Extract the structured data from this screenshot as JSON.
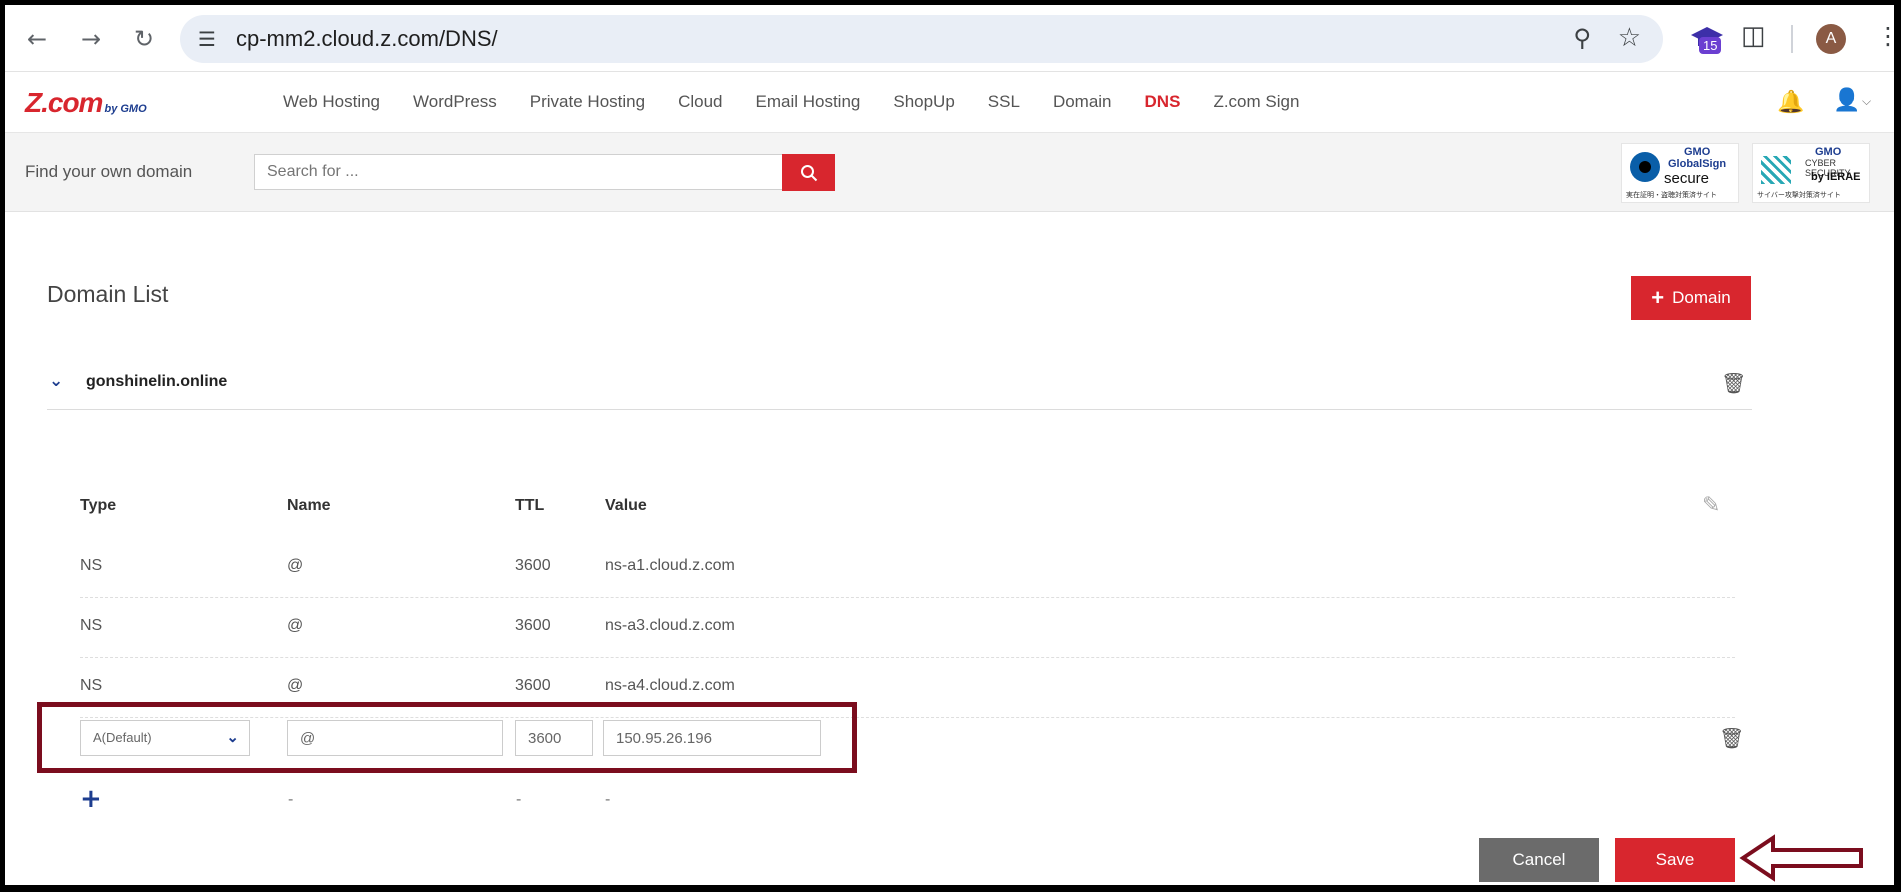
{
  "browser": {
    "url": "cp-mm2.cloud.z.com/DNS/",
    "extension_badge": "15",
    "avatar_letter": "A",
    "icons": [
      "back-icon",
      "forward-icon",
      "reload-icon",
      "site-settings-icon",
      "zoom-icon",
      "star-icon",
      "extension-icon",
      "puzzle-icon",
      "kebab-menu-icon"
    ]
  },
  "site": {
    "logo_main": "Z.com",
    "logo_by": "by GMO",
    "nav": [
      "Web Hosting",
      "WordPress",
      "Private Hosting",
      "Cloud",
      "Email Hosting",
      "ShopUp",
      "SSL",
      "Domain",
      "DNS",
      "Z.com Sign"
    ],
    "active_nav": "DNS",
    "accent_color": "#d8262e",
    "brand_blue": "#1d3d8f"
  },
  "search": {
    "label": "Find your own domain",
    "placeholder": "Search for ..."
  },
  "badges": {
    "gms": {
      "line1": "GMO",
      "line2": "GlobalSign",
      "line3": "secure",
      "footer": "実在証明・盗聴対策済サイト"
    },
    "cyber": {
      "line1": "GMO",
      "line2": "CYBER SECURITY",
      "line3": "by IERAE",
      "footer": "サイバー攻撃対策済サイト"
    }
  },
  "main": {
    "title": "Domain List",
    "add_domain_label": "Domain",
    "domain": "gonshinelin.online",
    "columns": {
      "type": "Type",
      "name": "Name",
      "ttl": "TTL",
      "value": "Value"
    },
    "records": [
      {
        "type": "NS",
        "name": "@",
        "ttl": "3600",
        "value": "ns-a1.cloud.z.com"
      },
      {
        "type": "NS",
        "name": "@",
        "ttl": "3600",
        "value": "ns-a3.cloud.z.com"
      },
      {
        "type": "NS",
        "name": "@",
        "ttl": "3600",
        "value": "ns-a4.cloud.z.com"
      }
    ],
    "new_record": {
      "type": "A(Default)",
      "name": "@",
      "ttl": "3600",
      "value": "150.95.26.196"
    },
    "placeholder_dash": "-",
    "cancel_label": "Cancel",
    "save_label": "Save",
    "annotation_color": "#7b0d1e"
  }
}
